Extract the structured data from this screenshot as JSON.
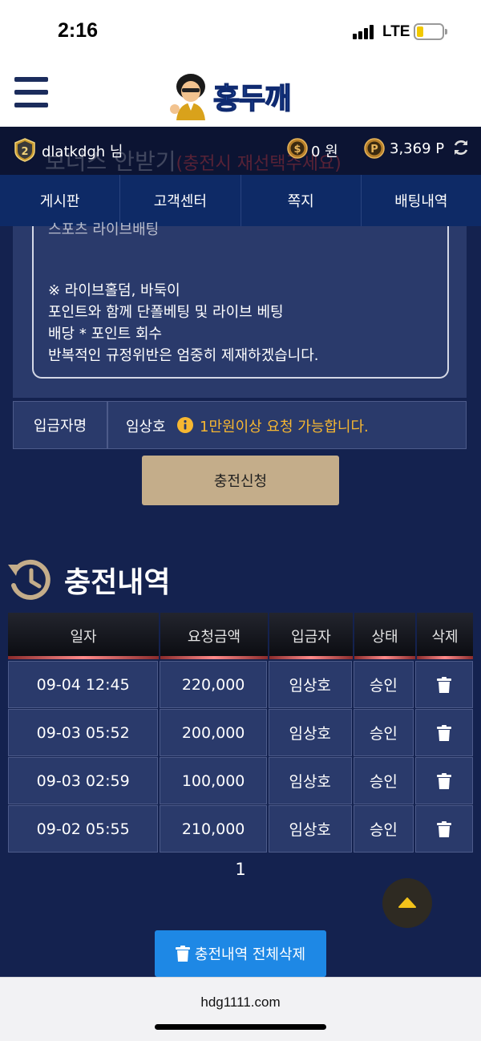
{
  "status_bar": {
    "time": "2:16",
    "network": "LTE"
  },
  "header": {
    "logo_text": "홍두깨"
  },
  "user": {
    "rank": "2",
    "username": "dlatkdgh 님",
    "money": "0 원",
    "points": "3,369 P",
    "ghost_title": "보너스 안받기",
    "ghost_note": "(충전시 재선택주세요)"
  },
  "nav": {
    "tabs": [
      "게시판",
      "고객센터",
      "쪽지",
      "배팅내역"
    ]
  },
  "notice": {
    "cutoff_line": "스포츠 라이브배팅",
    "lines": [
      "※ 라이브홀덤, 바둑이",
      "포인트와 함께 단폴베팅 및 라이브 베팅",
      "배당 * 포인트 회수",
      "반복적인 규정위반은 엄중히 제재하겠습니다."
    ]
  },
  "depositor": {
    "label": "입금자명",
    "name": "임상호",
    "notice": "1만원이상 요청 가능합니다."
  },
  "charge_button": "충전신청",
  "history": {
    "title": "충전내역",
    "headers": [
      "일자",
      "요청금액",
      "입금자",
      "상태",
      "삭제"
    ],
    "rows": [
      {
        "date": "09-04 12:45",
        "amount": "220,000",
        "depositor": "임상호",
        "status": "승인"
      },
      {
        "date": "09-03 05:52",
        "amount": "200,000",
        "depositor": "임상호",
        "status": "승인"
      },
      {
        "date": "09-03 02:59",
        "amount": "100,000",
        "depositor": "임상호",
        "status": "승인"
      },
      {
        "date": "09-02 05:55",
        "amount": "210,000",
        "depositor": "임상호",
        "status": "승인"
      }
    ],
    "page": "1",
    "delete_all": "충전내역 전체삭제"
  },
  "browser": {
    "url": "hdg1111.com"
  },
  "colors": {
    "accent_blue": "#1e88e5",
    "warning": "#f7b731",
    "charge_button": "#c4ad8a",
    "nav_bg": "#0e2a66"
  }
}
